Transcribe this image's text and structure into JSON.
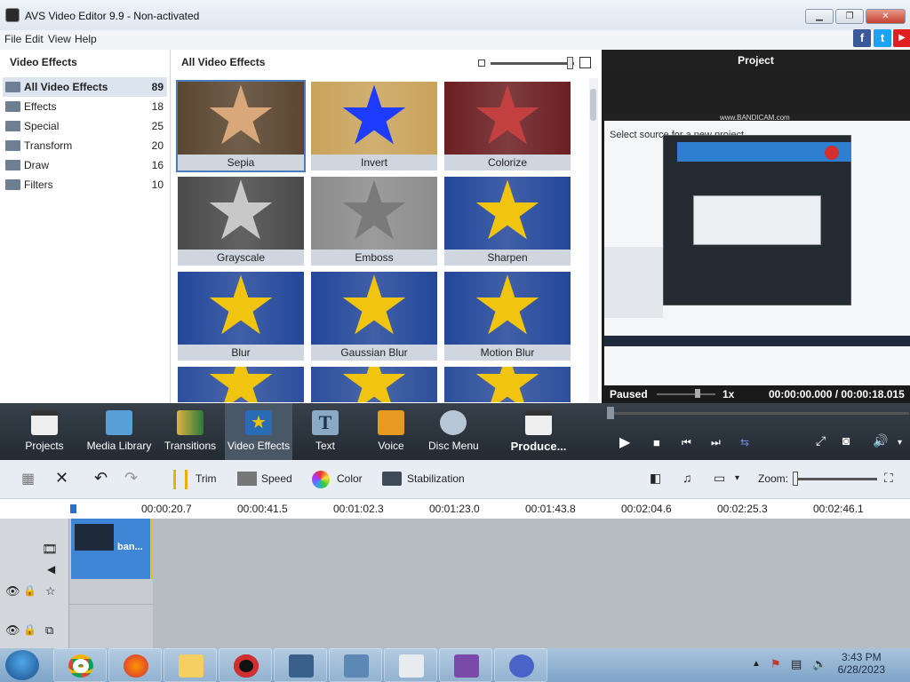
{
  "window": {
    "title": "AVS Video Editor 9.9 - Non-activated",
    "min": "▁",
    "max": "❐",
    "close": "✕"
  },
  "menu": [
    "File",
    "Edit",
    "View",
    "Help"
  ],
  "social": {
    "facebook": "f",
    "twitter": "t",
    "youtube": "▶"
  },
  "left_panel": {
    "title": "Video Effects",
    "categories": [
      {
        "label": "All Video Effects",
        "count": "89"
      },
      {
        "label": "Effects",
        "count": "18"
      },
      {
        "label": "Special",
        "count": "25"
      },
      {
        "label": "Transform",
        "count": "20"
      },
      {
        "label": "Draw",
        "count": "16"
      },
      {
        "label": "Filters",
        "count": "10"
      }
    ]
  },
  "grid": {
    "title": "All Video Effects",
    "effects": [
      {
        "label": "Sepia",
        "star": "#d8a77a",
        "bg": "#5a4630"
      },
      {
        "label": "Invert",
        "star": "#1e3cff",
        "bg": "#c9a35b"
      },
      {
        "label": "Colorize",
        "star": "#c24040",
        "bg": "#6b1f22"
      },
      {
        "label": "Grayscale",
        "star": "#c8c8c8",
        "bg": "#4a4a4a"
      },
      {
        "label": "Emboss",
        "star": "#7a7a7a",
        "bg": "#8c8c8c"
      },
      {
        "label": "Sharpen",
        "star": "#f1c40f",
        "bg": "#23479a"
      },
      {
        "label": "Blur",
        "star": "#f1c40f",
        "bg": "#23479a"
      },
      {
        "label": "Gaussian Blur",
        "star": "#f1c40f",
        "bg": "#23479a"
      },
      {
        "label": "Motion Blur",
        "star": "#f1c40f",
        "bg": "#23479a"
      },
      {
        "label": "",
        "star": "#f1c40f",
        "bg": "#2d4f9c"
      },
      {
        "label": "",
        "star": "#f1c40f",
        "bg": "#2d4f9c"
      },
      {
        "label": "",
        "star": "#f1c40f",
        "bg": "#2d4f9c"
      }
    ]
  },
  "preview": {
    "title": "Project",
    "screen_banner": "www.BANDICAM.com",
    "screen_heading": "Select source for a new project",
    "status": "Paused",
    "speed": "1x",
    "time": "00:00:00.000 / 00:00:18.015"
  },
  "toolbar": [
    {
      "label": "Projects",
      "icon": "clapper-icon",
      "color": "#e9e9e9"
    },
    {
      "label": "Media Library",
      "icon": "film-icon",
      "color": "#5aa0d8"
    },
    {
      "label": "Transitions",
      "icon": "transition-icon",
      "color": "#e0b040"
    },
    {
      "label": "Video Effects",
      "icon": "star-icon",
      "color": "#2a6bb5"
    },
    {
      "label": "Text",
      "icon": "text-icon",
      "color": "#8aa9c6"
    },
    {
      "label": "Voice",
      "icon": "mic-icon",
      "color": "#e89a20"
    },
    {
      "label": "Disc Menu",
      "icon": "disc-icon",
      "color": "#b8c7d8"
    },
    {
      "label": "Produce...",
      "icon": "produce-icon",
      "color": "#e9e9e9"
    }
  ],
  "editbar": {
    "trim": "Trim",
    "speed": "Speed",
    "color": "Color",
    "stabilization": "Stabilization",
    "zoom": "Zoom:"
  },
  "ruler": [
    "00:00:20.7",
    "00:00:41.5",
    "00:01:02.3",
    "00:01:23.0",
    "00:01:43.8",
    "00:02:04.6",
    "00:02:25.3",
    "00:02:46.1"
  ],
  "clip": {
    "label": "ban..."
  },
  "clock": {
    "time": "3:43 PM",
    "date": "6/28/2023"
  }
}
